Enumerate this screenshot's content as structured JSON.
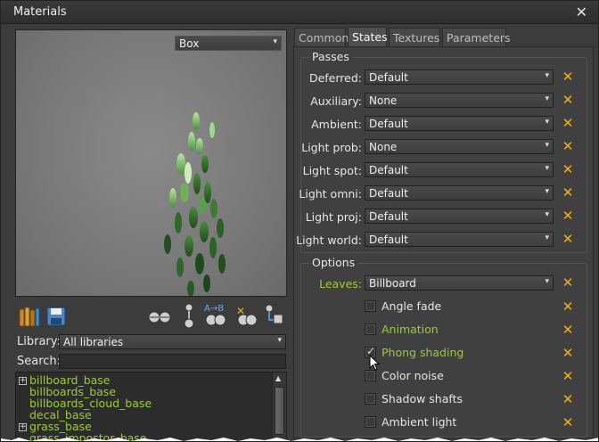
{
  "window": {
    "title": "Materials"
  },
  "preview": {
    "mesh_select": "Box"
  },
  "toolbar": {
    "icons": [
      "library-books-icon",
      "save-icon",
      "spheres-icon",
      "sphere-hierarchy-icon",
      "ab-reparent-icon",
      "delete-spheres-icon",
      "clone-icon"
    ]
  },
  "library": {
    "label": "Library:",
    "value": "All libraries"
  },
  "search": {
    "label": "Search:",
    "value": ""
  },
  "material_list": {
    "items": [
      {
        "label": "billboard_base",
        "expandable": true
      },
      {
        "label": "billboards_base",
        "expandable": false
      },
      {
        "label": "billboards_cloud_base",
        "expandable": false
      },
      {
        "label": "decal_base",
        "expandable": false
      },
      {
        "label": "grass_base",
        "expandable": true
      },
      {
        "label": "grass_impostor_base",
        "expandable": false
      }
    ]
  },
  "tabs": [
    {
      "label": "Common",
      "active": false
    },
    {
      "label": "States",
      "active": true
    },
    {
      "label": "Textures",
      "active": false
    },
    {
      "label": "Parameters",
      "active": false
    }
  ],
  "passes": {
    "title": "Passes",
    "rows": [
      {
        "label": "Deferred:",
        "value": "Default"
      },
      {
        "label": "Auxiliary:",
        "value": "None"
      },
      {
        "label": "Ambient:",
        "value": "Default"
      },
      {
        "label": "Light prob:",
        "value": "None"
      },
      {
        "label": "Light spot:",
        "value": "Default"
      },
      {
        "label": "Light omni:",
        "value": "Default"
      },
      {
        "label": "Light proj:",
        "value": "Default"
      },
      {
        "label": "Light world:",
        "value": "Default"
      }
    ]
  },
  "options": {
    "title": "Options",
    "leaves": {
      "label": "Leaves:",
      "value": "Billboard"
    },
    "checks": [
      {
        "label": "Angle fade",
        "checked": false,
        "modified": false
      },
      {
        "label": "Animation",
        "checked": false,
        "modified": true
      },
      {
        "label": "Phong shading",
        "checked": true,
        "modified": true
      },
      {
        "label": "Color noise",
        "checked": false,
        "modified": false
      },
      {
        "label": "Shadow shafts",
        "checked": false,
        "modified": false
      },
      {
        "label": "Ambient light",
        "checked": false,
        "modified": false
      }
    ]
  },
  "colors": {
    "accent_green": "#9ccc33",
    "reset_orange": "#e8b21a"
  }
}
